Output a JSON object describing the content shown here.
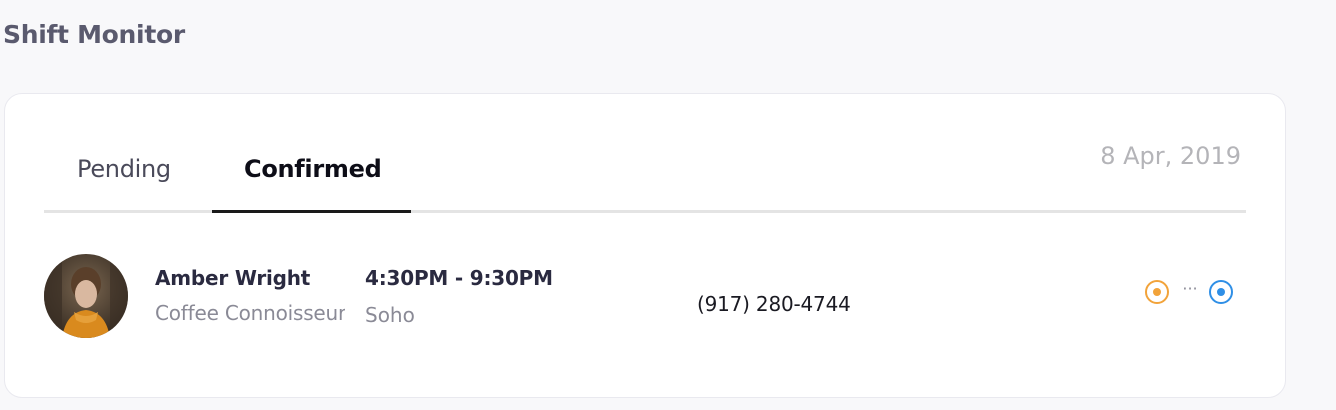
{
  "page_title": "Shift Monitor",
  "tabs": [
    {
      "label": "Pending",
      "active": false
    },
    {
      "label": "Confirmed",
      "active": true
    }
  ],
  "date": "8 Apr, 2019",
  "shift": {
    "name": "Amber Wright",
    "role": "Coffee Connoisseur",
    "time": "4:30PM - 9:30PM",
    "location": "Soho",
    "phone": "(917) 280-4744",
    "status": {
      "start_icon": "target-icon",
      "start_color": "#f2a33a",
      "connector": "···",
      "end_icon": "target-icon",
      "end_color": "#2f8fe6"
    }
  }
}
